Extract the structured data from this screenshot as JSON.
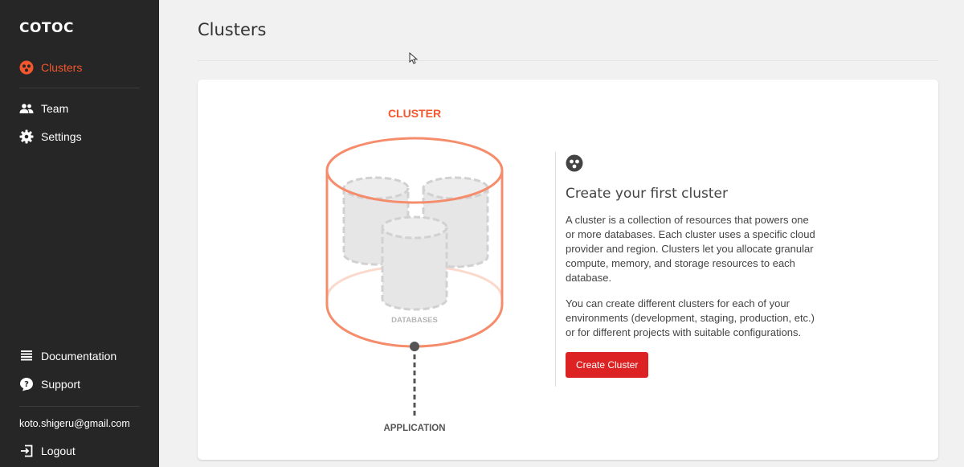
{
  "sidebar": {
    "brand": "COTOC",
    "items": [
      {
        "label": "Clusters",
        "icon": "clusters-icon"
      },
      {
        "label": "Team",
        "icon": "team-icon"
      },
      {
        "label": "Settings",
        "icon": "gear-icon"
      }
    ],
    "bottom_items": [
      {
        "label": "Documentation",
        "icon": "document-icon"
      },
      {
        "label": "Support",
        "icon": "help-icon"
      }
    ],
    "user_email": "koto.shigeru@gmail.com",
    "logout_label": "Logout"
  },
  "main": {
    "title": "Clusters",
    "illustration": {
      "cluster_label": "CLUSTER",
      "databases_label": "DATABASES",
      "application_label": "APPLICATION"
    },
    "empty_state": {
      "heading": "Create your first cluster",
      "paragraph1": "A cluster is a collection of resources that powers one or more databases. Each cluster uses a specific cloud provider and region. Clusters let you allocate granular compute, memory, and storage resources to each database.",
      "paragraph2": "You can create different clusters for each of your environments (development, staging, production, etc.) or for different projects with suitable configurations.",
      "button_label": "Create Cluster"
    }
  },
  "colors": {
    "sidebar_bg": "#262626",
    "accent": "#f3572d",
    "button": "#dc2222",
    "cluster_stroke": "#f58c6c"
  }
}
